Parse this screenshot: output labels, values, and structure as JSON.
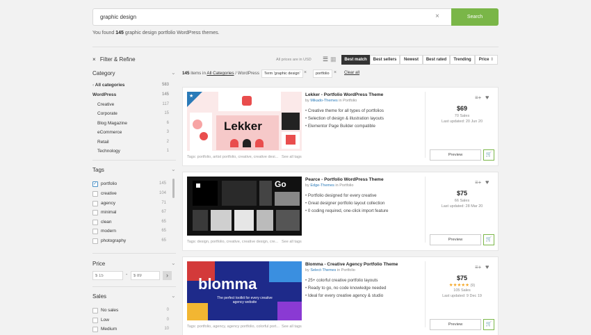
{
  "search": {
    "value": "graphic design",
    "button_label": "Search",
    "clear_icon": "×"
  },
  "results_summary": {
    "prefix": "You found ",
    "count": "145",
    "suffix": " graphic design portfolio WordPress themes."
  },
  "filter_header": {
    "close_icon": "×",
    "label": "Filter & Refine"
  },
  "category": {
    "title": "Category",
    "all_label": "All categories",
    "all_count": "583",
    "wordpress_label": "WordPress",
    "wordpress_count": "145",
    "items": [
      {
        "label": "Creative",
        "count": "117"
      },
      {
        "label": "Corporate",
        "count": "15"
      },
      {
        "label": "Blog Magazine",
        "count": "6"
      },
      {
        "label": "eCommerce",
        "count": "3"
      },
      {
        "label": "Retail",
        "count": "2"
      },
      {
        "label": "Technology",
        "count": "1"
      }
    ]
  },
  "tags": {
    "title": "Tags",
    "items": [
      {
        "label": "portfolio",
        "count": "145",
        "checked": true
      },
      {
        "label": "creative",
        "count": "104",
        "checked": false
      },
      {
        "label": "agency",
        "count": "71",
        "checked": false
      },
      {
        "label": "minimal",
        "count": "67",
        "checked": false
      },
      {
        "label": "clean",
        "count": "65",
        "checked": false
      },
      {
        "label": "modern",
        "count": "65",
        "checked": false
      },
      {
        "label": "photography",
        "count": "65",
        "checked": false
      }
    ]
  },
  "price_filter": {
    "title": "Price",
    "min_placeholder": "$ 15",
    "max_placeholder": "$ 89",
    "separator": "-",
    "go_icon": "›"
  },
  "sales_filter": {
    "title": "Sales",
    "items": [
      {
        "label": "No sales",
        "count": "0"
      },
      {
        "label": "Low",
        "count": "0"
      },
      {
        "label": "Medium",
        "count": "10"
      }
    ]
  },
  "toolbar": {
    "prices_note": "All prices are in USD",
    "sort_options": [
      "Best match",
      "Best sellers",
      "Newest",
      "Best rated",
      "Trending",
      "Price"
    ],
    "active_sort": "Best match",
    "price_arrow": "⇕"
  },
  "breadcrumb": {
    "count": "145",
    "items_in": " items in ",
    "all_categories": "All Categories",
    "separator": " / ",
    "current": "WordPress"
  },
  "active_filters": {
    "chips": [
      "Term 'graphic design'",
      "portfolio"
    ],
    "clear_all": "Clear all"
  },
  "items": [
    {
      "title": "Lekker - Portfolio WordPress Theme",
      "author_prefix": "by ",
      "author": "Mikado-Themes",
      "category": " in Portfolio",
      "features": [
        "Creative theme for all types of portfolios",
        "Selection of design & illustration layouts",
        "Elementor Page Builder compatible"
      ],
      "tags": "Tags: portfolio, artist portfolio, creative, creative desi...",
      "see_all": "See all tags",
      "price": "$69",
      "sales": "70 Sales",
      "updated": "Last updated: 20 Jun 20",
      "preview_label": "Preview",
      "thumb_text": "Lekker"
    },
    {
      "title": "Pearce - Portfolio WordPress Theme",
      "author_prefix": "by ",
      "author": "Edge-Themes",
      "category": " in Portfolio",
      "features": [
        "Portfolio designed for every creative",
        "Great designer portfolio layout collection",
        "0 coding required, one-click import feature"
      ],
      "tags": "Tags: design, portfolio, creative, creative design, cre...",
      "see_all": "See all tags",
      "price": "$75",
      "sales": "66 Sales",
      "updated": "Last updated: 28 Mar 20",
      "preview_label": "Preview",
      "thumb_text": "Go"
    },
    {
      "title": "Blomma - Creative Agency Portfolio Theme",
      "author_prefix": "by ",
      "author": "Select-Themes",
      "category": " in Portfolio",
      "features": [
        "25+ colorful creative portfolio layouts",
        "Ready to go, no code knowledge needed",
        "Ideal for every creative agency & studio"
      ],
      "tags": "Tags: portfolio, agency, agency portfolio, colorful port...",
      "see_all": "See all tags",
      "price": "$75",
      "rating_stars": "★★★★★",
      "rating_count": " (9)",
      "sales": "105 Sales",
      "updated": "Last updated: 9 Dec 19",
      "preview_label": "Preview",
      "thumb_text": "blomma",
      "thumb_tagline": "The perfect toolkit for every creative agency website"
    }
  ],
  "colors": {
    "accent_green": "#7ab648",
    "link_blue": "#2a7ab8",
    "star": "#f5a623"
  }
}
